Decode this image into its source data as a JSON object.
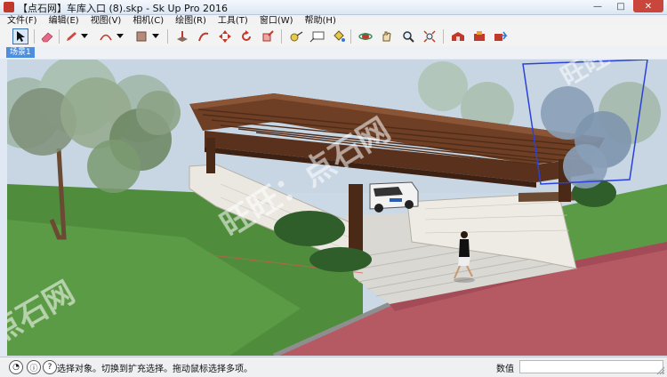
{
  "window": {
    "title": "【点石网】车库入口 (8).skp - Sk  Up Pro 2016",
    "min_symbol": "—",
    "max_symbol": "□",
    "close_symbol": "✕"
  },
  "menu": [
    "文件(F)",
    "编辑(E)",
    "视图(V)",
    "相机(C)",
    "绘图(R)",
    "工具(T)",
    "窗口(W)",
    "帮助(H)"
  ],
  "toolbar": {
    "tools": [
      "select-icon",
      "eraser-icon",
      "pencil-icon",
      "arc-icon",
      "rectangle-icon",
      "push-pull-icon",
      "follow-me-icon",
      "move-icon",
      "rotate-icon",
      "scale-icon",
      "tape-measure-icon",
      "text-icon",
      "paint-bucket-icon",
      "orbit-icon",
      "pan-icon",
      "zoom-icon",
      "zoom-extents-icon",
      "warehouse-icon",
      "extension-icon",
      "share-icon"
    ],
    "active": "select-icon"
  },
  "scene": {
    "tab_label": "场景1"
  },
  "viewport": {
    "watermarks": [
      "旺旺：点石网",
      "点石网",
      "旺旺："
    ]
  },
  "status": {
    "message": "选择对象。切换到扩充选择。拖动鼠标选择多项。",
    "measure_label": "数值",
    "measure_value": ""
  }
}
